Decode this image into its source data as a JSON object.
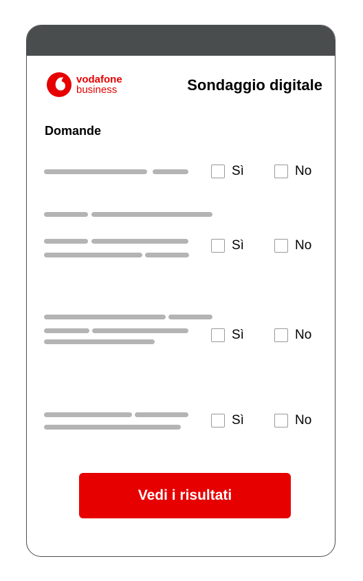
{
  "brand": {
    "name_line1": "vodafone",
    "name_line2": "business",
    "color": "#e60000"
  },
  "header": {
    "title": "Sondaggio digitale",
    "bar_color": "#4a4d4e"
  },
  "survey": {
    "section_label": "Domande",
    "questions": [
      {
        "yes_label": "Sì",
        "no_label": "No"
      },
      {
        "yes_label": "Sì",
        "no_label": "No"
      },
      {
        "yes_label": "Sì",
        "no_label": "No"
      },
      {
        "yes_label": "Sì",
        "no_label": "No"
      }
    ]
  },
  "cta": {
    "label": "Vedi i risultati"
  }
}
